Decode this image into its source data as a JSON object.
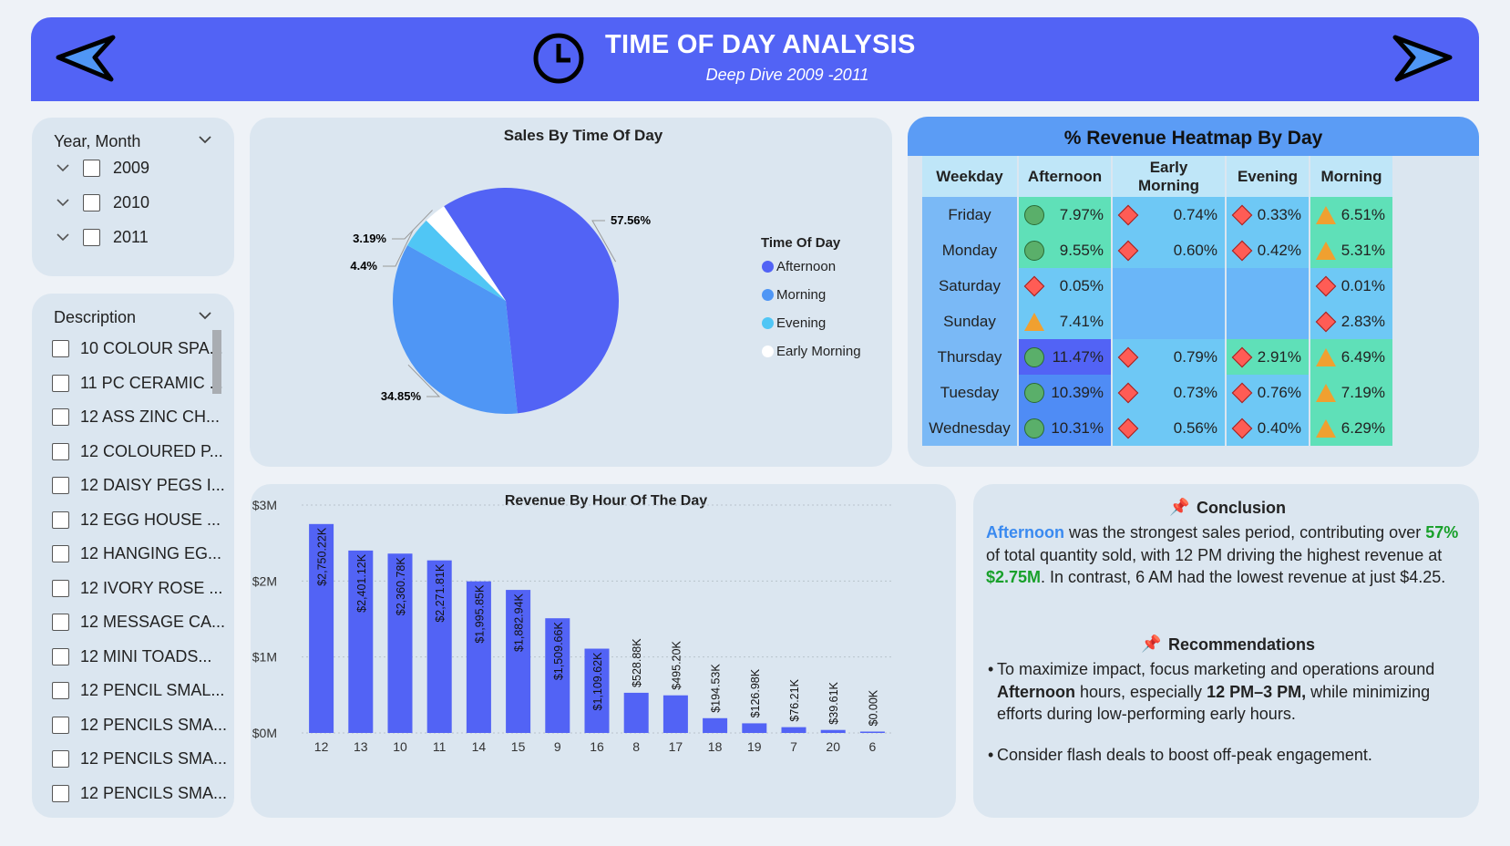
{
  "header": {
    "title": "TIME OF DAY ANALYSIS",
    "subtitle": "Deep Dive 2009 -2011"
  },
  "year_slicer": {
    "title": "Year, Month",
    "items": [
      "2009",
      "2010",
      "2011"
    ]
  },
  "desc_slicer": {
    "title": "Description",
    "items": [
      "10 COLOUR SPA...",
      "11 PC CERAMIC ...",
      "12 ASS ZINC CH...",
      "12 COLOURED P...",
      "12 DAISY PEGS I...",
      "12 EGG HOUSE ...",
      "12 HANGING EG...",
      "12 IVORY ROSE ...",
      "12 MESSAGE CA...",
      "12 MINI TOADS...",
      "12 PENCIL SMAL...",
      "12 PENCILS SMA...",
      "12 PENCILS SMA...",
      "12 PENCILS SMA..."
    ]
  },
  "pie": {
    "title": "Sales By Time Of Day",
    "legend_title": "Time Of Day",
    "legend": [
      "Afternoon",
      "Morning",
      "Evening",
      "Early Morning"
    ],
    "colors": [
      "#5263f5",
      "#4f96f5",
      "#50c6f5",
      "#ffffff"
    ]
  },
  "bar": {
    "title": "Revenue By Hour Of The Day",
    "color": "#5263f5"
  },
  "chart_data": [
    {
      "type": "pie",
      "title": "Sales By Time Of Day",
      "legend_title": "Time Of Day",
      "categories": [
        "Afternoon",
        "Morning",
        "Evening",
        "Early Morning"
      ],
      "values": [
        57.56,
        34.85,
        4.4,
        3.19
      ],
      "labels": [
        "57.56%",
        "34.85%",
        "4.4%",
        "3.19%"
      ],
      "legend_position": "right"
    },
    {
      "type": "bar",
      "title": "Revenue By Hour Of The Day",
      "categories": [
        "12",
        "13",
        "10",
        "11",
        "14",
        "15",
        "9",
        "16",
        "8",
        "17",
        "18",
        "19",
        "7",
        "20",
        "6"
      ],
      "values": [
        2750220,
        2401120,
        2360780,
        2271810,
        1995850,
        1882940,
        1509660,
        1109620,
        528880,
        495200,
        194530,
        126980,
        76210,
        39610,
        4.25
      ],
      "labels": [
        "$2,750.22K",
        "$2,401.12K",
        "$2,360.78K",
        "$2,271.81K",
        "$1,995.85K",
        "$1,882.94K",
        "$1,509.66K",
        "$1,109.62K",
        "$528.88K",
        "$495.20K",
        "$194.53K",
        "$126.98K",
        "$76.21K",
        "$39.61K",
        "$0.00K"
      ],
      "yticks": [
        "$0M",
        "$1M",
        "$2M",
        "$3M"
      ],
      "ylim": [
        0,
        3000000
      ],
      "grid": true
    }
  ],
  "heatmap": {
    "title": "% Revenue Heatmap By Day",
    "columns": [
      "Weekday",
      "Afternoon",
      "Early Morning",
      "Evening",
      "Morning"
    ],
    "rows": [
      {
        "day": "Friday",
        "cells": [
          {
            "v": "7.97%",
            "m": "circle",
            "bg": "#5fe0b8"
          },
          {
            "v": "0.74%",
            "m": "diamond",
            "bg": "#6ec8f5"
          },
          {
            "v": "0.33%",
            "m": "diamond",
            "bg": "#6ec8f5"
          },
          {
            "v": "6.51%",
            "m": "triangle",
            "bg": "#5fe0b8"
          }
        ]
      },
      {
        "day": "Monday",
        "cells": [
          {
            "v": "9.55%",
            "m": "circle",
            "bg": "#5fe0b8"
          },
          {
            "v": "0.60%",
            "m": "diamond",
            "bg": "#6ec8f5"
          },
          {
            "v": "0.42%",
            "m": "diamond",
            "bg": "#6ec8f5"
          },
          {
            "v": "5.31%",
            "m": "triangle",
            "bg": "#5fe0b8"
          }
        ]
      },
      {
        "day": "Saturday",
        "cells": [
          {
            "v": "0.05%",
            "m": "diamond",
            "bg": "#6ec8f5"
          },
          {
            "v": "",
            "m": "",
            "bg": "#6ab6f8"
          },
          {
            "v": "",
            "m": "",
            "bg": "#6ab6f8"
          },
          {
            "v": "0.01%",
            "m": "diamond",
            "bg": "#6ec8f5"
          }
        ]
      },
      {
        "day": "Sunday",
        "cells": [
          {
            "v": "7.41%",
            "m": "triangle",
            "bg": "#6ec8f5"
          },
          {
            "v": "",
            "m": "",
            "bg": "#6ab6f8"
          },
          {
            "v": "",
            "m": "",
            "bg": "#6ab6f8"
          },
          {
            "v": "2.83%",
            "m": "diamond",
            "bg": "#6ec8f5"
          }
        ]
      },
      {
        "day": "Thursday",
        "cells": [
          {
            "v": "11.47%",
            "m": "circle",
            "bg": "#5263f5"
          },
          {
            "v": "0.79%",
            "m": "diamond",
            "bg": "#6ec8f5"
          },
          {
            "v": "2.91%",
            "m": "diamond",
            "bg": "#5fe0b8"
          },
          {
            "v": "6.49%",
            "m": "triangle",
            "bg": "#5fe0b8"
          }
        ]
      },
      {
        "day": "Tuesday",
        "cells": [
          {
            "v": "10.39%",
            "m": "circle",
            "bg": "#4f8cf5"
          },
          {
            "v": "0.73%",
            "m": "diamond",
            "bg": "#6ec8f5"
          },
          {
            "v": "0.76%",
            "m": "diamond",
            "bg": "#6ec8f5"
          },
          {
            "v": "7.19%",
            "m": "triangle",
            "bg": "#5fe0b8"
          }
        ]
      },
      {
        "day": "Wednesday",
        "cells": [
          {
            "v": "10.31%",
            "m": "circle",
            "bg": "#4f8cf5"
          },
          {
            "v": "0.56%",
            "m": "diamond",
            "bg": "#6ec8f5"
          },
          {
            "v": "0.40%",
            "m": "diamond",
            "bg": "#6ec8f5"
          },
          {
            "v": "6.29%",
            "m": "triangle",
            "bg": "#5fe0b8"
          }
        ]
      }
    ]
  },
  "conclusion": {
    "title": "Conclusion",
    "t1": "Afternoon",
    "t2": " was the strongest sales period, contributing over ",
    "t3": "57%",
    "t4": " of total quantity sold, with 12 PM driving the highest revenue at ",
    "t5": "$2.75M",
    "t6": ". In contrast, 6 AM had the lowest revenue at just $4.25."
  },
  "recommendations": {
    "title": "Recommendations",
    "b1a": "To maximize impact, focus marketing and operations around ",
    "b1b": "Afternoon",
    "b1c": " hours, especially ",
    "b1d": "12 PM–3 PM,",
    "b1e": " while minimizing efforts during low-performing early hours.",
    "b2": "Consider flash deals to boost off-peak engagement.",
    "bullet": "•"
  }
}
